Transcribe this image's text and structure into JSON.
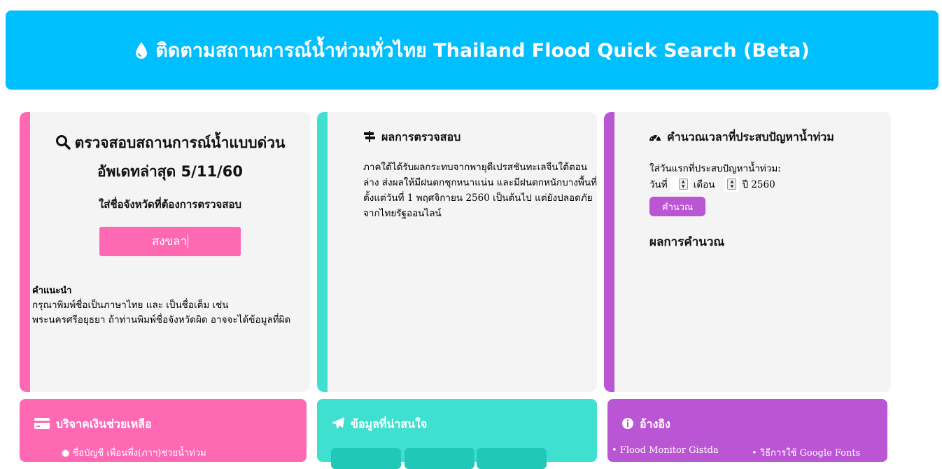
{
  "header": {
    "icon": "droplet-icon",
    "title": "ติดตามสถานการณ์น้ำท่วมทั่วไทย Thailand Flood Quick Search (Beta)"
  },
  "search_card": {
    "icon": "search-icon",
    "title_line1": "ตรวจสอบสถานการณ์น้ำแบบด่วน",
    "title_line2": "อัพเดทล่าสุด 5/11/60",
    "prompt": "ใส่ชื่อจังหวัดที่ต้องการตรวจสอบ",
    "input_value": "สงขลา",
    "hint_title": "คำแนะนำ",
    "hint_text": "กรุณาพิมพ์ชื่อเป็นภาษาไทย และ เป็นชื่อเต็ม เช่น พระนครศรีอยุธยา ถ้าท่านพิมพ์ชื่อจังหวัดผิด อาจจะได้ข้อมูลที่ผิด"
  },
  "result_card": {
    "icon": "signpost-icon",
    "title": "ผลการตรวจสอบ",
    "body": "ภาคใต้ได้รับผลกระทบจากพายุดีเปรสชันทะเลจีนใต้ตอนล่าง ส่งผลให้มีฝนตกชุกหนาแน่น และมีฝนตกหนักบางพื้นที่ ตั้งแต่วันที่ 1 พฤศจิกายน 2560 เป็นต้นไป แต่ยังปลอดภัย จากไทยรัฐออนไลน์"
  },
  "calc_card": {
    "icon": "dashboard-icon",
    "title": "คำนวณเวลาที่ประสบปัญหาน้ำท่วม",
    "label": "ใส่วันแรกที่ประสบปัญหาน้ำท่วม:",
    "day_label": "วันที่",
    "month_label": "เดือน",
    "year_label": "ปี 2560",
    "button": "คำนวณ",
    "result_title": "ผลการคำนวณ"
  },
  "bottom": {
    "donate": {
      "icon": "credit-card-icon",
      "title": "บริจาคเงินช่วยเหลือ",
      "peek": "● ชื่อบัญชี เพื่อนพึ่ง(ภาฯ)ช่วยน้ำท่วม"
    },
    "info": {
      "icon": "paper-plane-icon",
      "title": "ข้อมูลที่น่าสนใจ"
    },
    "ref": {
      "icon": "info-circle-icon",
      "title": "อ้างอิง",
      "peek1": "• Flood Monitor Gistda",
      "peek2": "• วิธีการใช้ Google Fonts"
    }
  },
  "colors": {
    "header": "#00bfff",
    "pink": "#ff69b4",
    "teal": "#40e0d0",
    "purple": "#ba55d3"
  }
}
